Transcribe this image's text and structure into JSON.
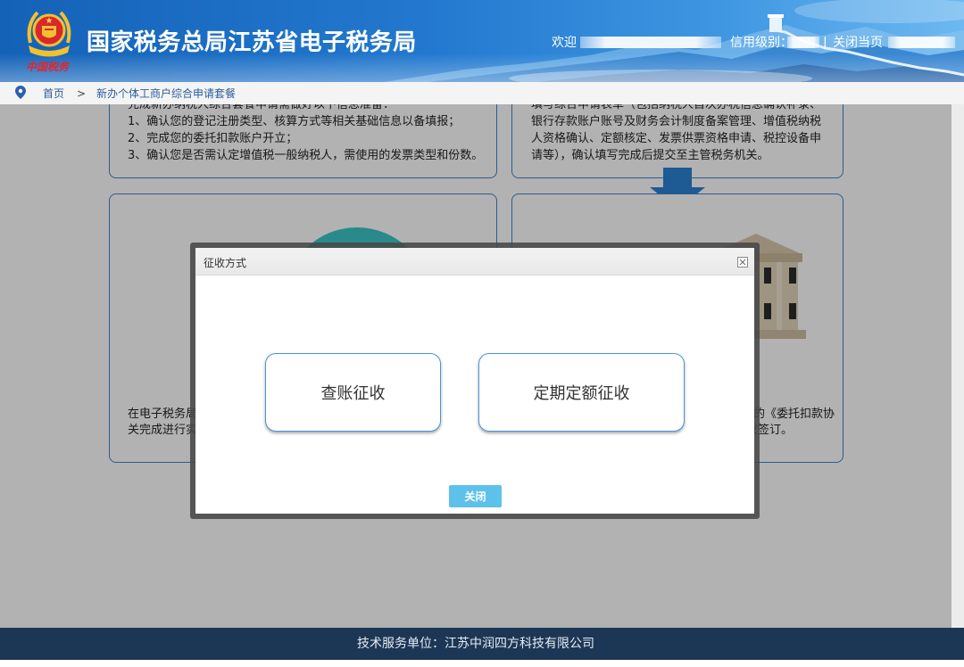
{
  "header": {
    "site_title": "国家税务总局江苏省电子税务局",
    "logo_slogan": "中国税务",
    "welcome_label": "欢迎",
    "credit_level_label": "信用级别：",
    "separator": "|",
    "close_page_link": "关闭当页"
  },
  "breadcrumb": {
    "home": "首页",
    "separator": ">",
    "current": "新办个体工商户综合申请套餐"
  },
  "step_cards": {
    "preparation": [
      "完成新办纳税人综合套餐申请需做好以下信息准备：",
      "1、确认您的登记注册类型、核算方式等相关基础信息以备填报；",
      "2、完成您的委托扣款账户开立；",
      "3、确认您是否需认定增值税一般纳税人，需使用的发票类型和份数。"
    ],
    "application_form": [
      "填写综合申请表单（包括纳税人首次办税信息确认补录、",
      "银行存款账户账号及财务会计制度备案管理、增值税纳税",
      "人资格确认、定额核定、发票供票资格申请、税控设备申",
      "请等），确认填写完成后提交至主管税务机关。"
    ],
    "etax_partial": [
      "在电子税务局",
      "关完成进行实"
    ],
    "bank_agreement_partial": [
      "的《委托扣款协",
      "议签订。"
    ]
  },
  "modal": {
    "title": "征收方式",
    "options": [
      "查账征收",
      "定期定额征收"
    ],
    "close_button": "关闭"
  },
  "footer": {
    "text": "技术服务单位：江苏中润四方科技有限公司"
  },
  "icons": {
    "emblem": "tax-emblem-icon",
    "breadcrumb": "location-pin-icon",
    "modal_close": "close-icon",
    "step_flow": "arrow-down-icon",
    "card_illustration": "building-icon"
  },
  "colors": {
    "header_blue": "#1462b8",
    "breadcrumb_link": "#2a5d9c",
    "card_border": "#3a86d0",
    "option_border": "#4d94db",
    "close_button_bg": "#5ec1ec",
    "footer_bg": "#1c3756",
    "slogan_red": "#e3262b"
  }
}
